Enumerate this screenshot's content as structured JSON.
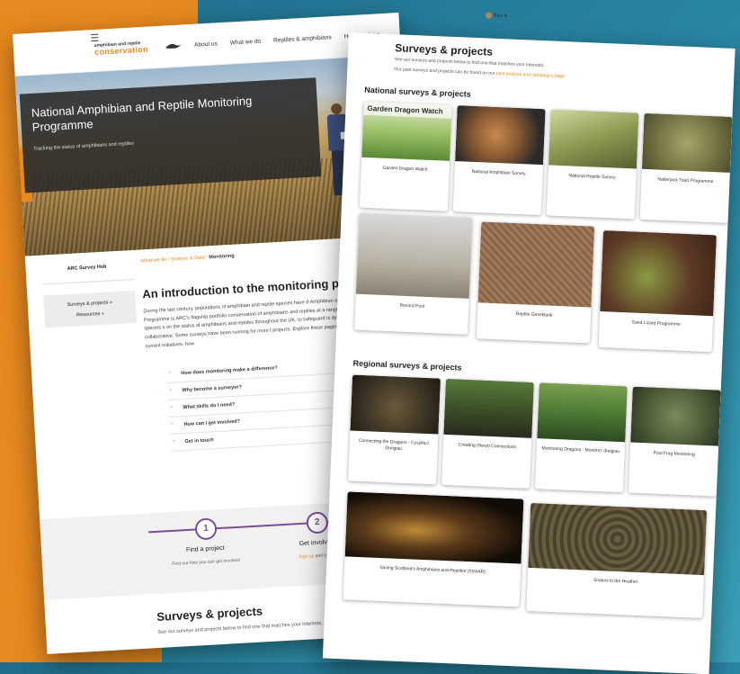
{
  "left_page": {
    "nav": {
      "logo_line1": "amphibian and reptile",
      "logo_line2": "conservation",
      "items": [
        "About us",
        "What we do",
        "Reptiles & amphibians",
        "Help & advice"
      ]
    },
    "hero": {
      "title": "National Amphibian and Reptile Monitoring Programme",
      "subtitle": "Tracking the status of amphibians and reptiles"
    },
    "sidebar": {
      "hub": "ARC Survey Hub",
      "items": [
        "Surveys & projects »",
        "Resources »"
      ]
    },
    "breadcrumb": {
      "part1": "What we do / Science & Data / ",
      "current": "Monitoring"
    },
    "intro": {
      "heading": "An introduction to the monitoring pro",
      "body": "During the last century, populations of amphibian and reptile species have d Amphibian and Reptile Monitoring Programme is ARC's flagship portfolio conservation of amphibians and reptiles at a range of scales. Our species s on the status of amphibians and reptiles throughout the UK, to safeguard is dynamic and collaborative. Some surveys have been running for more t projects. Explore these pages for information on current initiatives, how"
    },
    "accordion": [
      "How does monitoring make a difference?",
      "Why become a surveyor?",
      "What skills do I need?",
      "How can I get involved?",
      "Get in touch"
    ],
    "steps": [
      {
        "num": "1",
        "label": "Find a project",
        "sub": "Find out how you can get involved"
      },
      {
        "num": "2",
        "label": "Get involved",
        "sub_link": "Sign up",
        "sub_rest": " and join in"
      }
    ],
    "lower": {
      "heading": "Surveys & projects",
      "text": "See our surveys and projects below to find one that matches your interests."
    }
  },
  "right_page": {
    "topbar": {
      "user": "Ben"
    },
    "title": "Surveys & projects",
    "subtitle": "See our surveys and projects below to find one that matches your interests.",
    "past_text": "Our past surveys and projects can be found on our ",
    "past_link": "past projects and campaigns page.",
    "national": {
      "heading": "National surveys & projects",
      "cards": [
        {
          "label": "Garden Dragon Watch",
          "overlay": "Garden Dragon Watch"
        },
        {
          "label": "National Amphibian Survey"
        },
        {
          "label": "National Reptile Survey"
        },
        {
          "label": "Natterjack Toad Programme"
        },
        {
          "label": "Record Pool"
        },
        {
          "label": "Reptile GeneBank"
        },
        {
          "label": "Sand Lizard Programme"
        }
      ]
    },
    "regional": {
      "heading": "Regional surveys & projects",
      "cards": [
        {
          "label": "Connecting the Dragons - Cysylltu'r Dreigiau"
        },
        {
          "label": "Creating (Newt) Connections"
        },
        {
          "label": "Monitoring Dragons - Monitro'r dreigiau"
        },
        {
          "label": "Pool Frog Monitoring"
        },
        {
          "label": "Saving Scotland's Amphibians and Reptiles (SSAAR)"
        },
        {
          "label": "Snakes in the Heather"
        }
      ]
    }
  },
  "colors": {
    "accent_orange": "#e8891f",
    "purple": "#7a4c9a",
    "background_teal": "#2a86a3"
  }
}
